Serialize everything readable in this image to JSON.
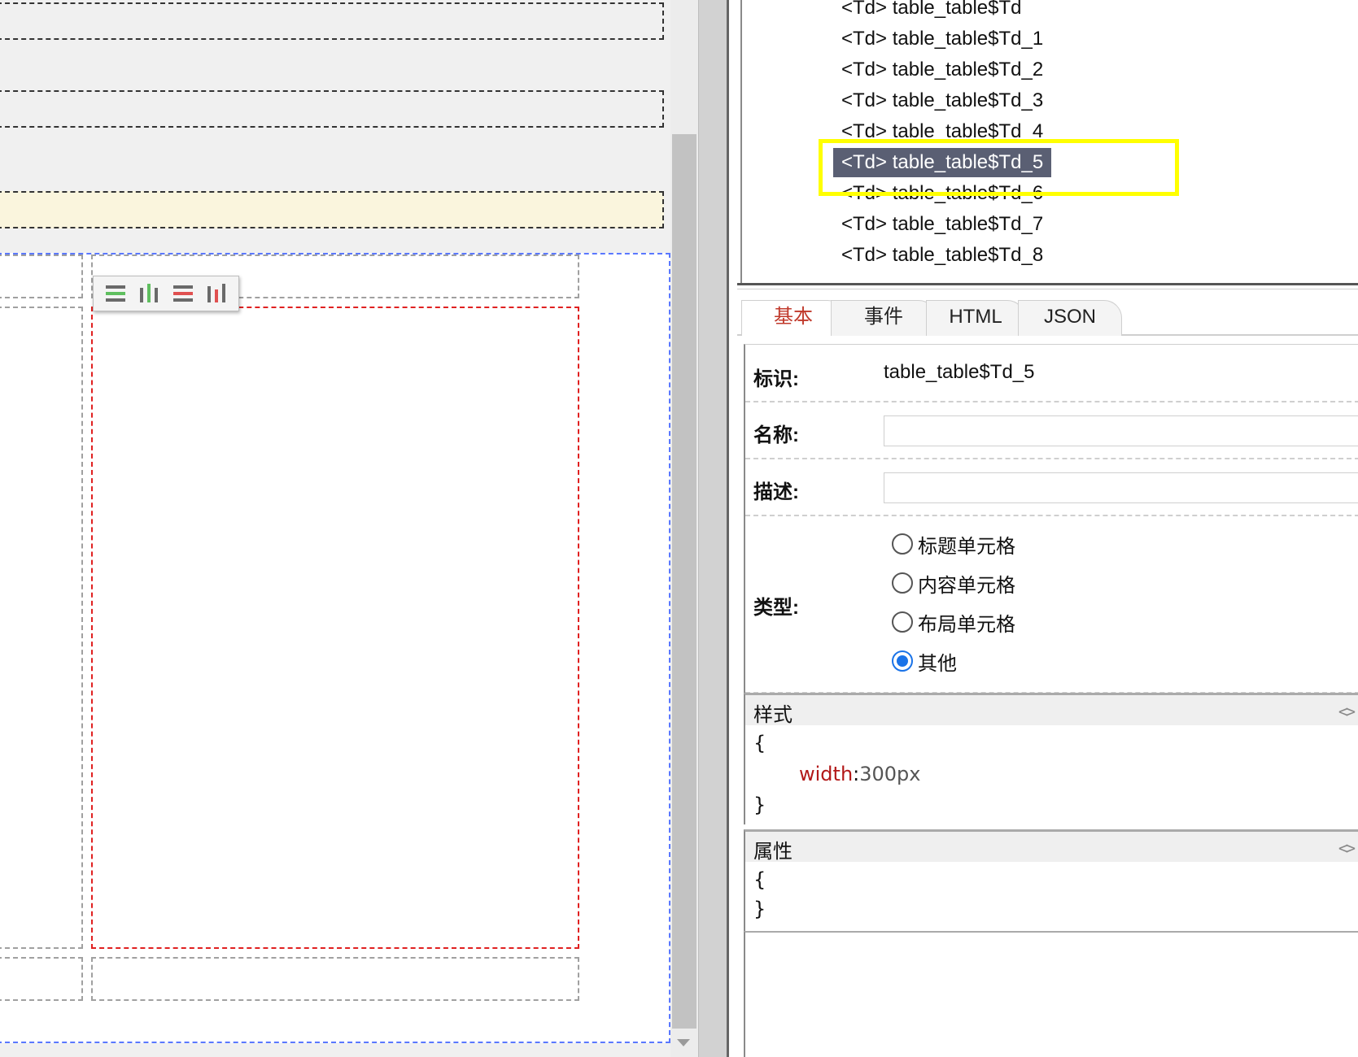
{
  "tree": {
    "items": [
      {
        "tag": "<Td>",
        "name": "table_table$Td"
      },
      {
        "tag": "<Td>",
        "name": "table_table$Td_1"
      },
      {
        "tag": "<Td>",
        "name": "table_table$Td_2"
      },
      {
        "tag": "<Td>",
        "name": "table_table$Td_3"
      },
      {
        "tag": "<Td>",
        "name": "table_table$Td_4"
      },
      {
        "tag": "<Td>",
        "name": "table_table$Td_5",
        "selected": true
      },
      {
        "tag": "<Td>",
        "name": "table_table$Td_6"
      },
      {
        "tag": "<Td>",
        "name": "table_table$Td_7"
      },
      {
        "tag": "<Td>",
        "name": "table_table$Td_8"
      }
    ],
    "highlight_color": "#ffff00",
    "selected_bg": "#5a5f73"
  },
  "tabs": [
    {
      "label": "基本",
      "active": true
    },
    {
      "label": "事件"
    },
    {
      "label": "HTML"
    },
    {
      "label": "JSON"
    }
  ],
  "form": {
    "id_label": "标识:",
    "id_value": "table_table$Td_5",
    "name_label": "名称:",
    "name_value": "",
    "desc_label": "描述:",
    "desc_value": "",
    "type_label": "类型:",
    "type_options": [
      {
        "label": "标题单元格",
        "checked": false
      },
      {
        "label": "内容单元格",
        "checked": false
      },
      {
        "label": "布局单元格",
        "checked": false
      },
      {
        "label": "其他",
        "checked": true
      }
    ]
  },
  "style_section": {
    "title": "样式",
    "open_brace": "{",
    "key": "width",
    "colon": ":",
    "value": "300px",
    "close_brace": "}"
  },
  "attr_section": {
    "title": "属性",
    "open_brace": "{",
    "close_brace": "}"
  },
  "icons": {
    "expand": "expand-code-icon",
    "toolbar": [
      "align-left-icon",
      "align-center-icon",
      "align-right-icon",
      "align-justify-icon"
    ]
  },
  "colors": {
    "active_tab": "#c0392b",
    "css_key": "#b21818",
    "radio_checked": "#1a73e8",
    "selected_cell_border": "#e02020",
    "table_border": "#5a78ff",
    "yellow_row": "#faf5dd"
  }
}
